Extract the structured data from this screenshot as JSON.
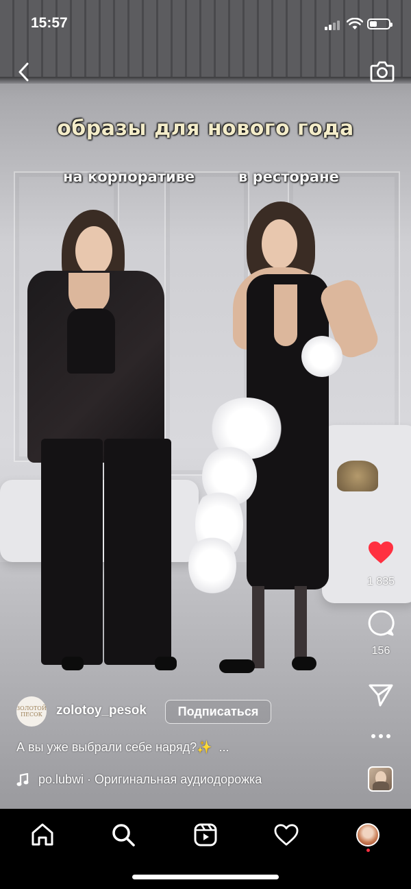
{
  "status_bar": {
    "time": "15:57"
  },
  "reel": {
    "overlay_title": "образы для нового года",
    "overlay_left_label": "на корпоративе",
    "overlay_right_label": "в ресторане"
  },
  "actions": {
    "likes_count": "1 835",
    "comments_count": "156",
    "like_color": "#ff3040"
  },
  "author": {
    "avatar_text_top": "ЗОЛОТОЙ",
    "avatar_text_bottom": "ПЕСОК",
    "username": "zolotoy_pesok",
    "follow_label": "Подписаться"
  },
  "caption": {
    "text": "А вы уже выбрали себе наряд?✨",
    "more": "..."
  },
  "audio": {
    "text": "po.lubwi · Оригинальная аудиодорожка"
  },
  "icons": {
    "back": "chevron-left-icon",
    "camera": "camera-icon",
    "like": "heart-icon",
    "comment": "comment-icon",
    "share": "send-icon",
    "more": "more-icon",
    "music": "music-note-icon",
    "nav": [
      "home-icon",
      "search-icon",
      "reels-icon",
      "activity-heart-icon",
      "profile-avatar"
    ]
  }
}
